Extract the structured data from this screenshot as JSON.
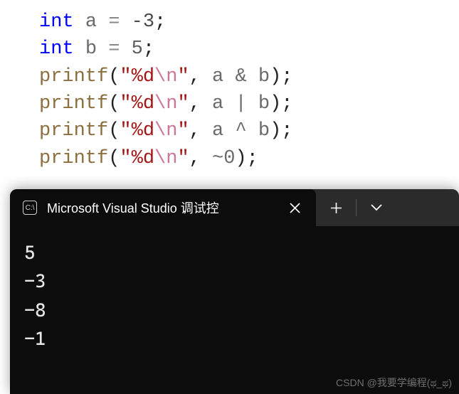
{
  "code": {
    "lines": [
      {
        "kw": "int",
        "ident": "a",
        "eq": "=",
        "val": "-3",
        "semi": ";"
      },
      {
        "kw": "int",
        "ident": "b",
        "eq": "=",
        "val": "5",
        "semi": ";"
      },
      {
        "func": "printf",
        "open": "(",
        "q1": "\"",
        "fmt": "%d",
        "esc": "\\n",
        "q2": "\"",
        "comma": ",",
        "arg": "a & b",
        "close": ")",
        "semi": ";"
      },
      {
        "func": "printf",
        "open": "(",
        "q1": "\"",
        "fmt": "%d",
        "esc": "\\n",
        "q2": "\"",
        "comma": ",",
        "arg": "a | b",
        "close": ")",
        "semi": ";"
      },
      {
        "func": "printf",
        "open": "(",
        "q1": "\"",
        "fmt": "%d",
        "esc": "\\n",
        "q2": "\"",
        "comma": ",",
        "arg": "a ^ b",
        "close": ")",
        "semi": ";"
      },
      {
        "func": "printf",
        "open": "(",
        "q1": "\"",
        "fmt": "%d",
        "esc": "\\n",
        "q2": "\"",
        "comma": ",",
        "arg": "~0",
        "close": ")",
        "semi": ";"
      }
    ]
  },
  "terminal": {
    "icon_label": "C:\\",
    "title": "Microsoft Visual Studio 调试控",
    "output": [
      "5",
      "-3",
      "-8",
      "-1"
    ]
  },
  "watermark": "CSDN @我要学编程(ಥ_ಥ)"
}
